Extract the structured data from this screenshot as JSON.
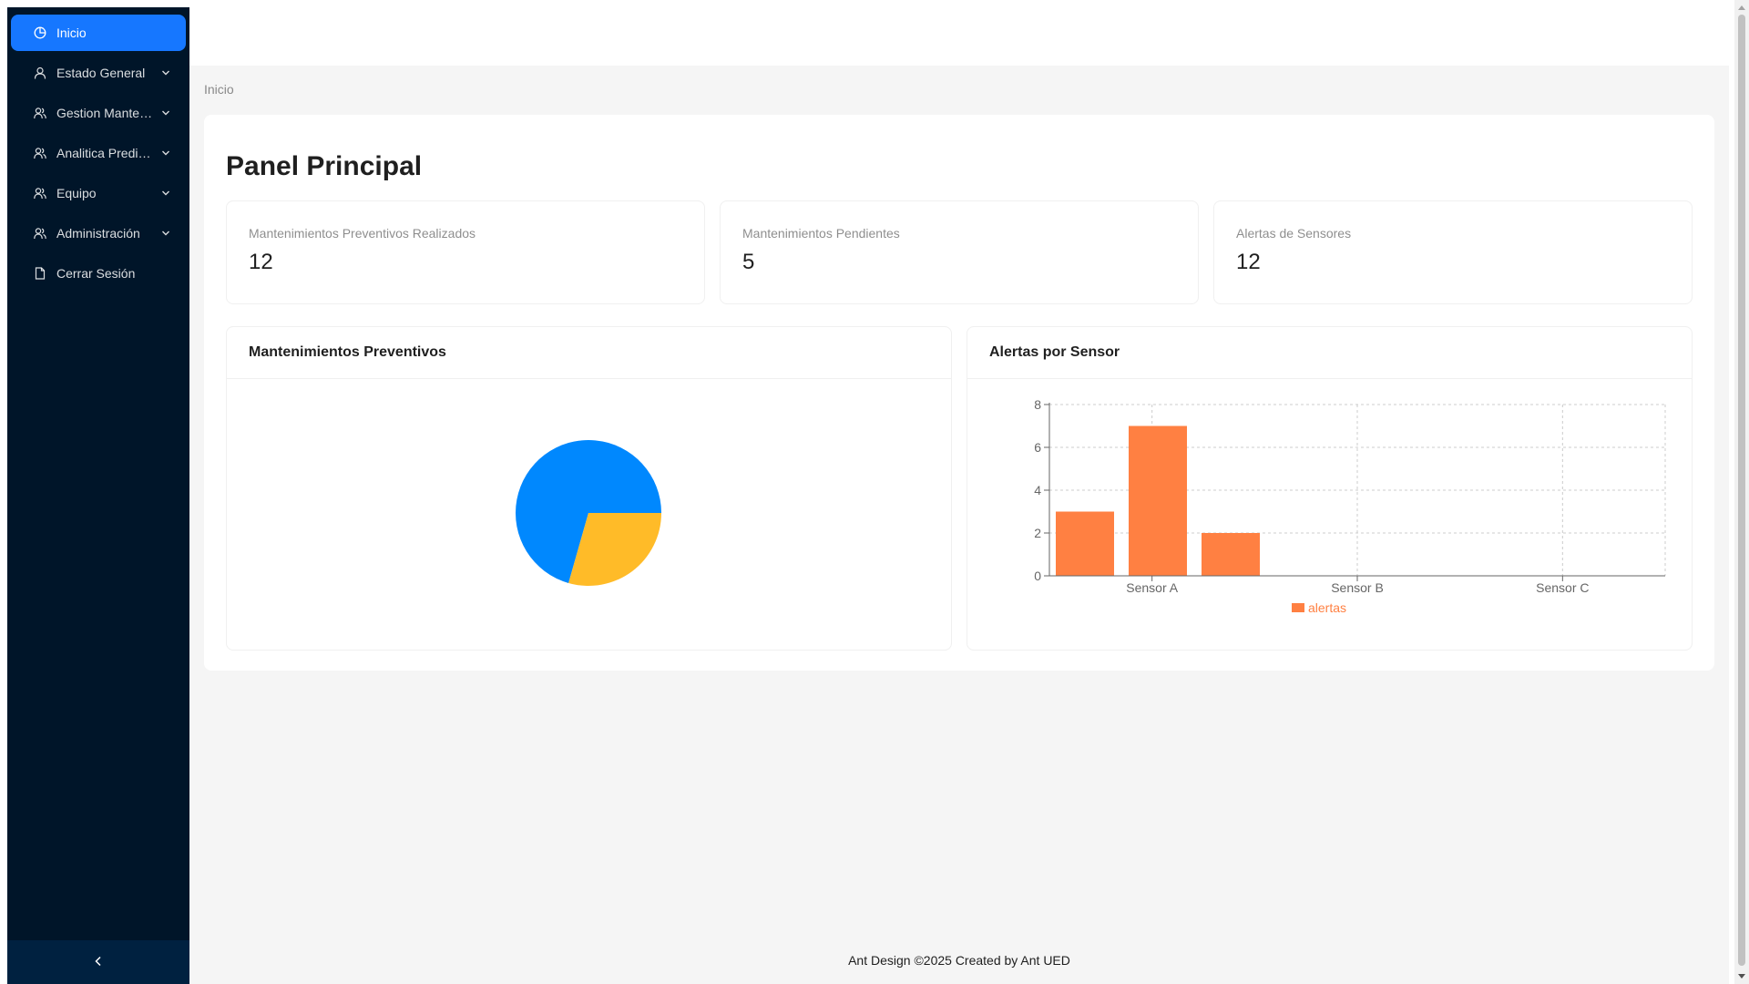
{
  "sidebar": {
    "items": [
      {
        "label": "Inicio",
        "icon": "pie-chart-icon",
        "active": true,
        "has_submenu": false
      },
      {
        "label": "Estado General",
        "icon": "user-icon",
        "active": false,
        "has_submenu": true
      },
      {
        "label": "Gestion Mantenimiento",
        "icon": "team-icon",
        "active": false,
        "has_submenu": true
      },
      {
        "label": "Analitica Predictiva",
        "icon": "team-icon",
        "active": false,
        "has_submenu": true
      },
      {
        "label": "Equipo",
        "icon": "team-icon",
        "active": false,
        "has_submenu": true
      },
      {
        "label": "Administración",
        "icon": "team-icon",
        "active": false,
        "has_submenu": true
      },
      {
        "label": "Cerrar Sesión",
        "icon": "file-icon",
        "active": false,
        "has_submenu": false
      }
    ],
    "collapse_icon": "chevron-left-icon"
  },
  "breadcrumb": "Inicio",
  "page_title": "Panel Principal",
  "stats": [
    {
      "title": "Mantenimientos Preventivos Realizados",
      "value": "12"
    },
    {
      "title": "Mantenimientos Pendientes",
      "value": "5"
    },
    {
      "title": "Alertas de Sensores",
      "value": "12"
    }
  ],
  "charts": {
    "preventive_title": "Mantenimientos Preventivos",
    "alerts_title": "Alertas por Sensor"
  },
  "chart_data": [
    {
      "type": "pie",
      "title": "Mantenimientos Preventivos",
      "slices": [
        {
          "value": 12,
          "color": "#0088fe"
        },
        {
          "value": 5,
          "color": "#ffbb28"
        }
      ]
    },
    {
      "type": "bar",
      "title": "Alertas por Sensor",
      "categories": [
        "Sensor A",
        "Sensor B",
        "Sensor C"
      ],
      "series": [
        {
          "name": "alertas",
          "values": [
            3,
            7,
            2
          ],
          "color": "#ff8042"
        }
      ],
      "ylim": [
        0,
        8
      ],
      "yticks": [
        0,
        2,
        4,
        6,
        8
      ],
      "grid": true,
      "legend": "bottom"
    }
  ],
  "footer": "Ant Design ©2025 Created by Ant UED",
  "colors": {
    "sider": "#001529",
    "accent": "#1677ff",
    "bar": "#ff8042",
    "pie_blue": "#0088fe",
    "pie_yellow": "#ffbb28"
  }
}
